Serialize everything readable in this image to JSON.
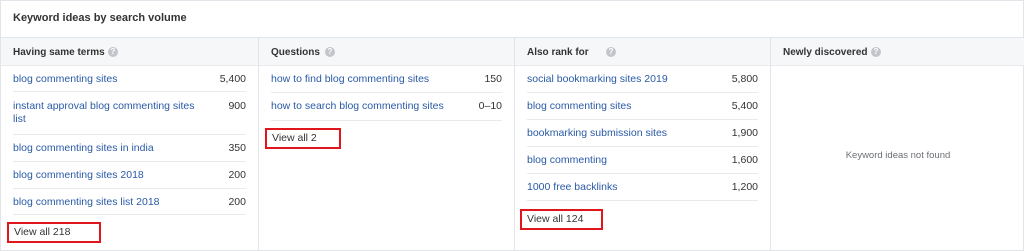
{
  "panel": {
    "title": "Keyword ideas by search volume"
  },
  "columns": [
    {
      "header": "Having same terms",
      "rows": [
        {
          "keyword": "blog commenting sites",
          "volume": "5,400"
        },
        {
          "keyword": "instant approval blog commenting sites list",
          "volume": "900"
        },
        {
          "keyword": "blog commenting sites in india",
          "volume": "350"
        },
        {
          "keyword": "blog commenting sites 2018",
          "volume": "200"
        },
        {
          "keyword": "blog commenting sites list 2018",
          "volume": "200"
        }
      ],
      "view_all": "View all 218"
    },
    {
      "header": "Questions",
      "rows": [
        {
          "keyword": "how to find blog commenting sites",
          "volume": "150"
        },
        {
          "keyword": "how to search blog commenting sites",
          "volume": "0–10"
        }
      ],
      "view_all": "View all 2"
    },
    {
      "header": "Also rank for",
      "rows": [
        {
          "keyword": "social bookmarking sites 2019",
          "volume": "5,800"
        },
        {
          "keyword": "blog commenting sites",
          "volume": "5,400"
        },
        {
          "keyword": "bookmarking submission sites",
          "volume": "1,900"
        },
        {
          "keyword": "blog commenting",
          "volume": "1,600"
        },
        {
          "keyword": "1000 free backlinks",
          "volume": "1,200"
        }
      ],
      "view_all": "View all 124"
    },
    {
      "header": "Newly discovered",
      "empty_message": "Keyword ideas not found"
    }
  ],
  "icons": {
    "help": "question-circle-icon"
  },
  "colors": {
    "link": "#2a5aa6",
    "highlight_box": "#e0161c",
    "header_bg": "#f6f7f9"
  }
}
